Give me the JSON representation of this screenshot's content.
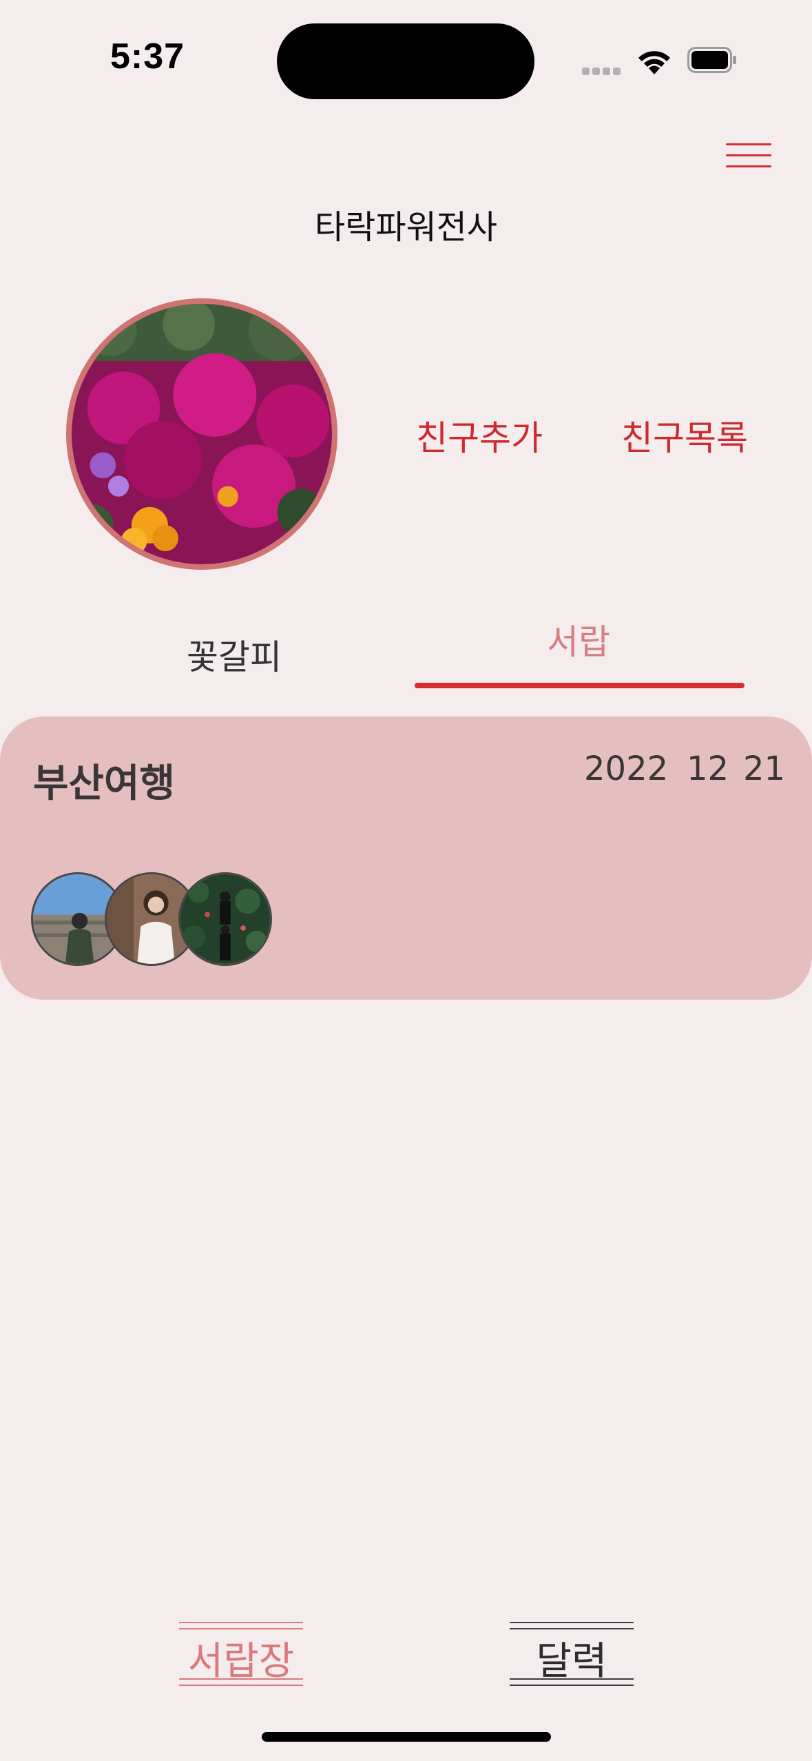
{
  "status_bar": {
    "time": "5:37"
  },
  "header": {
    "nickname": "타락파워전사"
  },
  "profile": {
    "add_friend_label": "친구추가",
    "friend_list_label": "친구목록"
  },
  "tabs": [
    {
      "label": "꽃갈피",
      "selected": false
    },
    {
      "label": "서랍",
      "selected": true
    }
  ],
  "card": {
    "title": "부산여행",
    "date": {
      "year": "2022",
      "month": "12",
      "day": "21"
    },
    "friend_avatars": [
      "friend-avatar-1",
      "friend-avatar-2",
      "friend-avatar-3"
    ]
  },
  "bottom_nav": [
    {
      "label": "서랍장",
      "active": true
    },
    {
      "label": "달력",
      "active": false
    }
  ],
  "colors": {
    "background": "#f5eced",
    "accent": "#d42e33",
    "card": "#e5bfbf",
    "inactive_tab": "#d47f82"
  }
}
